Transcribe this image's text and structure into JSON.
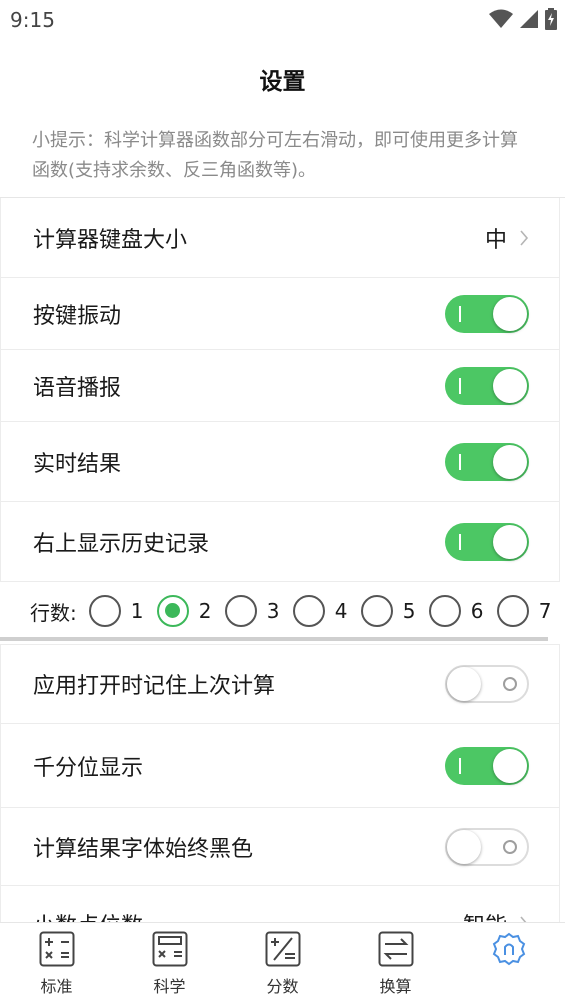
{
  "status_bar": {
    "time": "9:15"
  },
  "header": {
    "title": "设置"
  },
  "tip": {
    "text": "小提示：科学计算器函数部分可左右滑动，即可使用更多计算函数(支持求余数、反三角函数等)。"
  },
  "settings": {
    "keyboard_size": {
      "label": "计算器键盘大小",
      "value": "中"
    },
    "key_vibration": {
      "label": "按键振动",
      "enabled": true
    },
    "voice_broadcast": {
      "label": "语音播报",
      "enabled": true
    },
    "realtime_result": {
      "label": "实时结果",
      "enabled": true
    },
    "show_history": {
      "label": "右上显示历史记录",
      "enabled": true
    },
    "history_rows": {
      "label": "行数:",
      "options": [
        "1",
        "2",
        "3",
        "4",
        "5",
        "6",
        "7"
      ],
      "selected": "2"
    },
    "remember_last": {
      "label": "应用打开时记住上次计算",
      "enabled": false
    },
    "thousands_separator": {
      "label": "千分位显示",
      "enabled": true
    },
    "result_black": {
      "label": "计算结果字体始终黑色",
      "enabled": false
    },
    "decimal_places": {
      "label": "小数点位数",
      "value": "智能"
    }
  },
  "tabs": [
    {
      "label": "标准",
      "icon": "standard-calculator-icon"
    },
    {
      "label": "科学",
      "icon": "scientific-calculator-icon"
    },
    {
      "label": "分数",
      "icon": "fraction-icon"
    },
    {
      "label": "换算",
      "icon": "conversion-icon"
    },
    {
      "label": "",
      "icon": "settings-gear-icon",
      "active": true
    }
  ],
  "colors": {
    "accent": "#4cc764",
    "radio_accent": "#3cb85a",
    "tab_active": "#4a90e2",
    "tip_text": "#8a8a8a"
  }
}
